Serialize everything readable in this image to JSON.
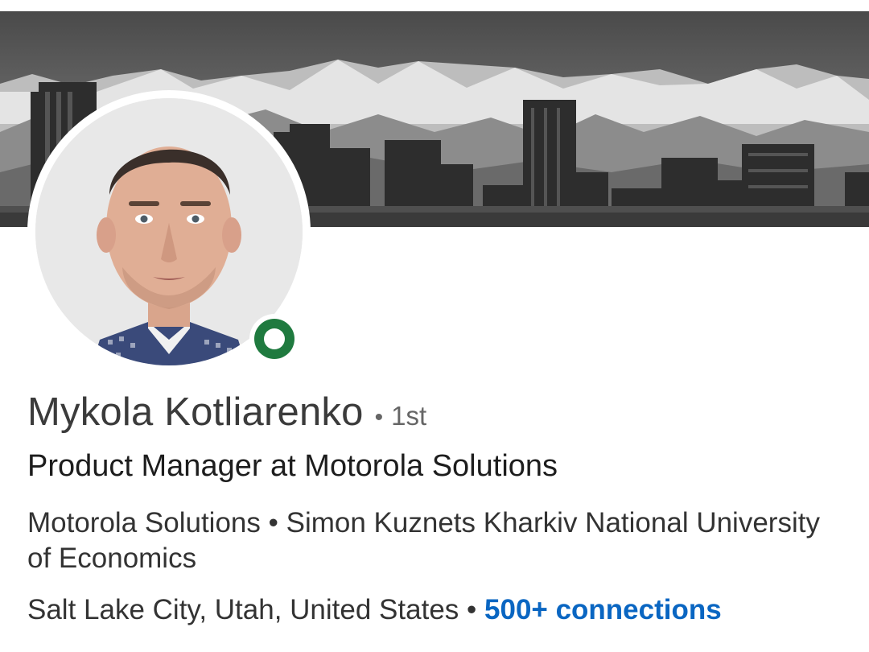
{
  "profile": {
    "name": "Mykola Kotliarenko",
    "separator": "•",
    "degree": "1st",
    "headline": "Product Manager at Motorola Solutions",
    "company": "Motorola Solutions",
    "education": "Simon  Kuznets Kharkiv National University of Economics",
    "location": "Salt Lake City, Utah, United States",
    "connections": "500+ connections",
    "status": "online"
  },
  "colors": {
    "online_green": "#1f7a3f",
    "link_blue": "#0a66c2",
    "name_gray": "#3b3b3b"
  },
  "icons": {
    "status": "online-status-icon"
  }
}
